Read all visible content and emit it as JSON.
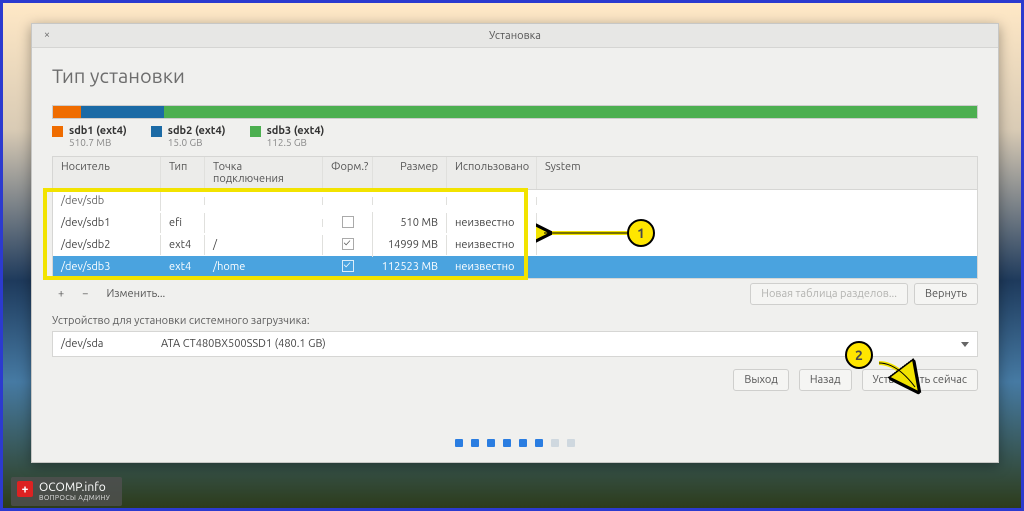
{
  "window_title": "Установка",
  "page_title": "Тип установки",
  "close_glyph": "×",
  "diskbar": {
    "seg1_pct": 3,
    "seg2_pct": 9,
    "seg3_pct": 88
  },
  "legend": [
    {
      "color": "#ef6c00",
      "label": "sdb1 (ext4)",
      "sub": "510.7 MB"
    },
    {
      "color": "#1b6aa5",
      "label": "sdb2 (ext4)",
      "sub": "15.0 GB"
    },
    {
      "color": "#4caf50",
      "label": "sdb3 (ext4)",
      "sub": "112.5 GB"
    }
  ],
  "columns": {
    "device": "Носитель",
    "type": "Тип",
    "mount": "Точка подключения",
    "format": "Форм.?",
    "size": "Размер",
    "used": "Использовано",
    "system": "System"
  },
  "rows": [
    {
      "dev": "/dev/sdb",
      "type": "",
      "mount": "",
      "format": null,
      "size": "",
      "used": "",
      "group": true
    },
    {
      "dev": "/dev/sdb1",
      "type": "efi",
      "mount": "",
      "format": false,
      "size": "510 MB",
      "used": "неизвестно"
    },
    {
      "dev": "/dev/sdb2",
      "type": "ext4",
      "mount": "/",
      "format": true,
      "size": "14999 MB",
      "used": "неизвестно"
    },
    {
      "dev": "/dev/sdb3",
      "type": "ext4",
      "mount": "/home",
      "format": true,
      "size": "112523 MB",
      "used": "неизвестно",
      "selected": true
    }
  ],
  "table_toolbar": {
    "plus": "+",
    "minus": "−",
    "change": "Изменить...",
    "new_table": "Новая таблица разделов...",
    "revert": "Вернуть"
  },
  "boot_label": "Устройство для установки системного загрузчика:",
  "boot_device": "/dev/sda",
  "boot_model": "ATA CT480BX500SSD1 (480.1 GB)",
  "footer": {
    "quit": "Выход",
    "back": "Назад",
    "install": "Установить сейчас"
  },
  "callouts": {
    "one": "1",
    "two": "2"
  },
  "logo": {
    "main": "OCOMP.info",
    "sub": "ВОПРОСЫ АДМИНУ"
  }
}
